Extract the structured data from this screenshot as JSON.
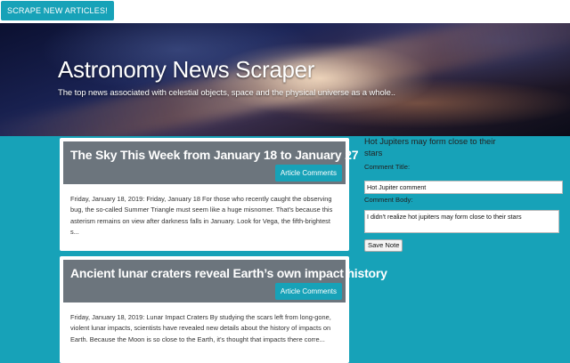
{
  "topbar": {
    "scrape_label": "SCRAPE NEW ARTICLES!"
  },
  "hero": {
    "title": "Astronomy News Scraper",
    "subtitle": "The top news associated with celestial objects, space and the physical universe as a whole.."
  },
  "articles": [
    {
      "title": "The Sky This Week from January 18 to January 27",
      "comments_label": "Article Comments",
      "summary": "Friday, January 18, 2019: Friday, January 18 For those who recently caught the observing bug, the so-called Summer Triangle must seem like a huge misnomer. That’s because this asterism remains on view after darkness falls in January. Look for Vega, the fifth-brightest s..."
    },
    {
      "title": "Ancient lunar craters reveal Earth’s own impact history",
      "comments_label": "Article Comments",
      "summary": "Friday, January 18, 2019: Lunar Impact Craters By studying the scars left from long-gone, violent lunar impacts, scientists have revealed new details about the history of impacts on Earth. Because the Moon is so close to the Earth, it’s thought that impacts there corre..."
    }
  ],
  "note": {
    "heading": "Hot Jupiters may form close to their stars",
    "title_label": "Comment Title:",
    "title_value": "Hot Jupiter comment",
    "body_label": "Comment Body:",
    "body_value": "I didn't realize hot jupiters may form close to their stars",
    "save_label": "Save Note"
  },
  "colors": {
    "accent": "#17a2b8",
    "card_header": "#6c757d",
    "background": "#17a2b8"
  }
}
